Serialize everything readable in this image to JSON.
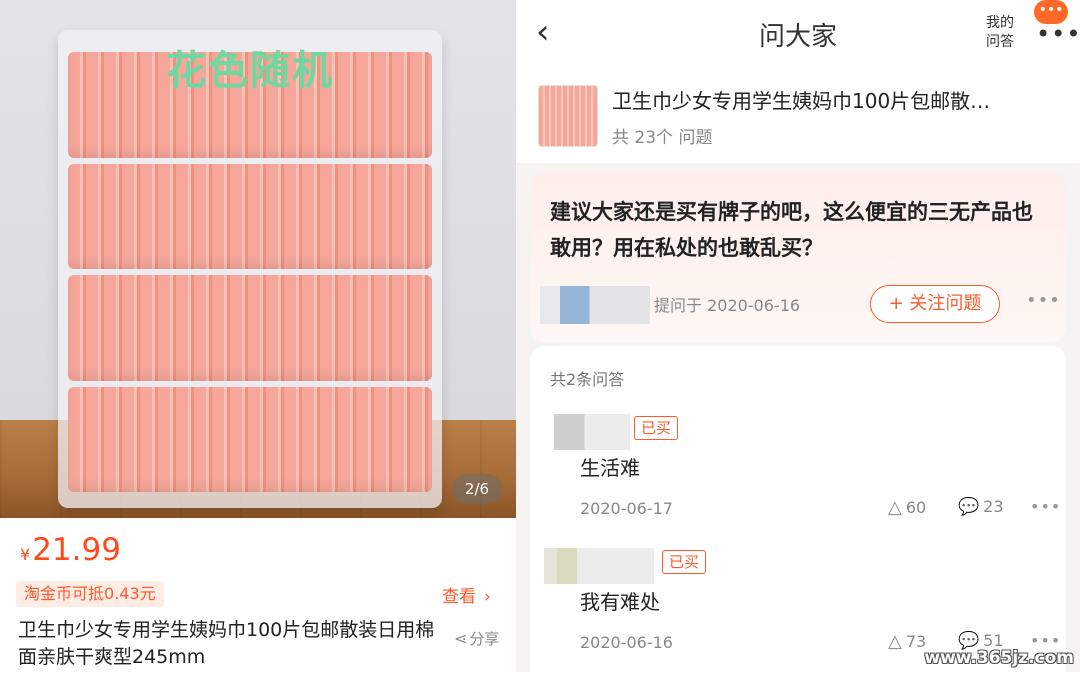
{
  "left": {
    "badge": "花色随机",
    "counter": "2/6",
    "price_currency": "¥",
    "price": "21.99",
    "coin": "淘金币可抵0.43元",
    "view": "查看",
    "title": "卫生巾少女专用学生姨妈巾100片包邮散装日用棉面亲肤干爽型245mm",
    "share": "分享"
  },
  "right": {
    "nav": {
      "back": "‹",
      "title": "问大家",
      "my_questions": "我的问答",
      "more": "•••",
      "badge": "•••"
    },
    "product": {
      "title": "卫生巾少女专用学生姨妈巾100片包邮散…",
      "count": "共 23个 问题"
    },
    "question": {
      "text": "建议大家还是买有牌子的吧，这么便宜的三无产品也敢用？用在私处的也敢乱买？",
      "asked": "提问于 2020-06-16",
      "follow": "+ 关注问题",
      "more": "•••"
    },
    "answers": {
      "count": "共2条问答",
      "items": [
        {
          "bought": "已买",
          "text": "生活难",
          "date": "2020-06-17",
          "likes": "60",
          "comments": "23",
          "more": "•••"
        },
        {
          "bought": "已买",
          "text": "我有难处",
          "date": "2020-06-16",
          "likes": "73",
          "comments": "51",
          "more": "•••"
        }
      ]
    }
  },
  "watermark": "www.365jz.com",
  "colors": {
    "accent": "#ff5a2b",
    "price": "#ff4a1c"
  }
}
